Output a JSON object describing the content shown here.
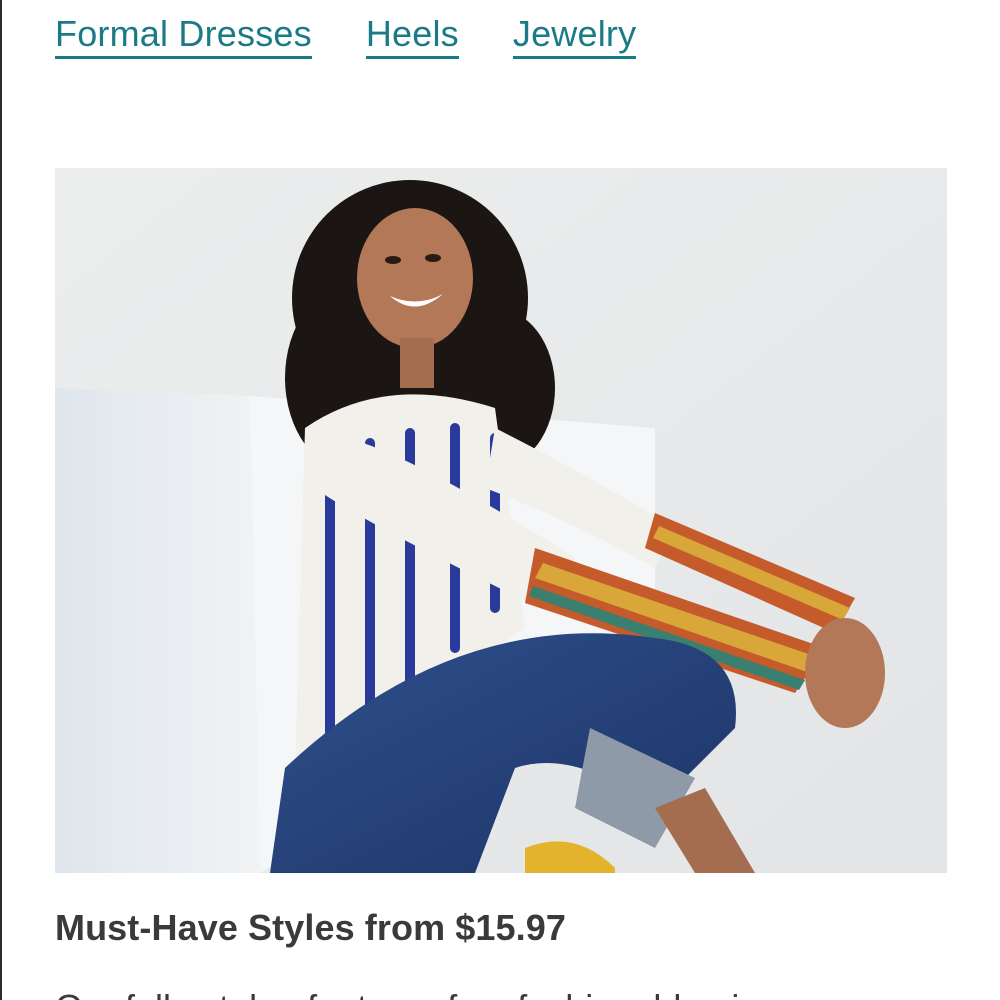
{
  "category_links": [
    {
      "label": "Formal Dresses"
    },
    {
      "label": "Heels"
    },
    {
      "label": "Jewelry"
    }
  ],
  "promo": {
    "image_alt": "",
    "headline": "Must-Have Styles from $15.97",
    "body": "Our fall catalog features fun, fashionable pieces"
  },
  "colors": {
    "link": "#1a7a86",
    "headline": "#3a3a3a",
    "background": "#ffffff"
  }
}
